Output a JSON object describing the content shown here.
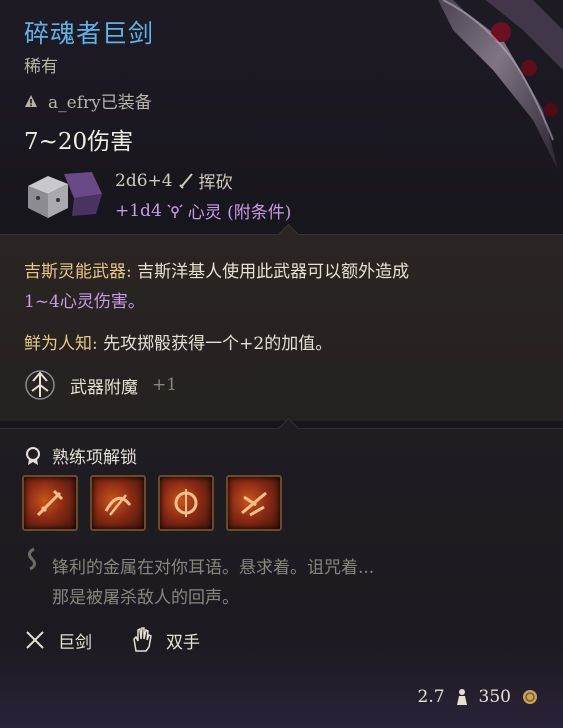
{
  "item": {
    "name": "碎魂者巨剑",
    "rarity": "稀有",
    "equipped_by": "a_efry已装备",
    "damage": "7~20伤害",
    "dmg_base": "2d6+4",
    "dmg_base_type": "挥砍",
    "dmg_bonus": "+1d4",
    "dmg_bonus_type": "心灵 (附条件)"
  },
  "desc": {
    "psionic_label": "吉斯灵能武器:",
    "psionic_text": "吉斯洋基人使用此武器可以额外造成",
    "psionic_value": "1~4心灵伤害。",
    "little_known_label": "鲜为人知:",
    "little_known_text": "先攻掷骰获得一个+2的加值。",
    "enchant_label": "武器附魔",
    "enchant_value": "+1"
  },
  "proficiency": {
    "title": "熟练项解锁",
    "skills": [
      "skill-1",
      "skill-2",
      "skill-3",
      "skill-4"
    ]
  },
  "flavor": {
    "line1": "锋利的金属在对你耳语。悬求着。诅咒着...",
    "line2": "那是被屠杀敌人的回声。"
  },
  "tags": {
    "type": "巨剑",
    "hands": "双手"
  },
  "footer": {
    "weight": "2.7",
    "price": "350"
  },
  "colors": {
    "title": "#5fb3e8",
    "psychic": "#c79be6",
    "gold": "#e6c78a"
  }
}
